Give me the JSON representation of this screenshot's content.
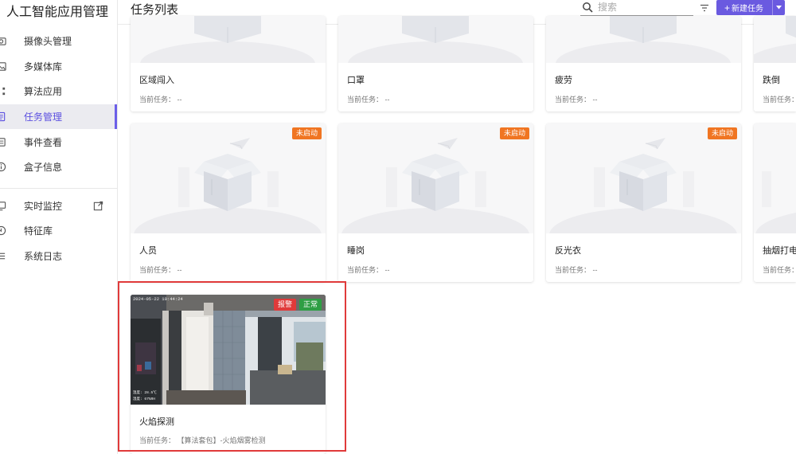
{
  "app": {
    "title": "人工智能应用管理"
  },
  "sidebar": {
    "items": [
      {
        "label": "摄像头管理",
        "icon": "camera-icon"
      },
      {
        "label": "多媒体库",
        "icon": "image-icon"
      },
      {
        "label": "算法应用",
        "icon": "grid-icon"
      },
      {
        "label": "任务管理",
        "icon": "document-icon",
        "active": true
      },
      {
        "label": "事件查看",
        "icon": "list-icon"
      },
      {
        "label": "盒子信息",
        "icon": "info-icon"
      },
      {
        "label": "实时监控",
        "icon": "monitor-icon",
        "external": true
      },
      {
        "label": "特征库",
        "icon": "face-icon"
      },
      {
        "label": "系统日志",
        "icon": "menu-icon"
      }
    ]
  },
  "header": {
    "title": "任务列表",
    "search_placeholder": "搜索",
    "new_button_label": "新建任务"
  },
  "task_prefix": "当前任务：",
  "cards_row1": [
    {
      "name": "区域闯入",
      "task": "--"
    },
    {
      "name": "口罩",
      "task": "--"
    },
    {
      "name": "疲劳",
      "task": "--"
    },
    {
      "name": "跌倒",
      "task": "--"
    }
  ],
  "cards_row2": [
    {
      "name": "人员",
      "task": "--",
      "status": "未启动"
    },
    {
      "name": "睡岗",
      "task": "--",
      "status": "未启动"
    },
    {
      "name": "反光衣",
      "task": "--",
      "status": "未启动"
    },
    {
      "name": "抽烟打电",
      "task": "--"
    }
  ],
  "card_row3": {
    "name": "火焰探测",
    "task": "【算法套包】-火焰烟雾检测",
    "badge_alarm": "报警",
    "badge_normal": "正常",
    "cam_timestamp": "2024-05-22 10:44:24",
    "cam_overlay_1": "温度: 28.5℃",
    "cam_overlay_2": "湿度: 67%RH"
  },
  "colors": {
    "accent": "#6a5ae0",
    "status_not_started": "#f07522",
    "alarm": "#e03a3a",
    "normal": "#2e9e44",
    "highlight_border": "#e03a3a"
  }
}
